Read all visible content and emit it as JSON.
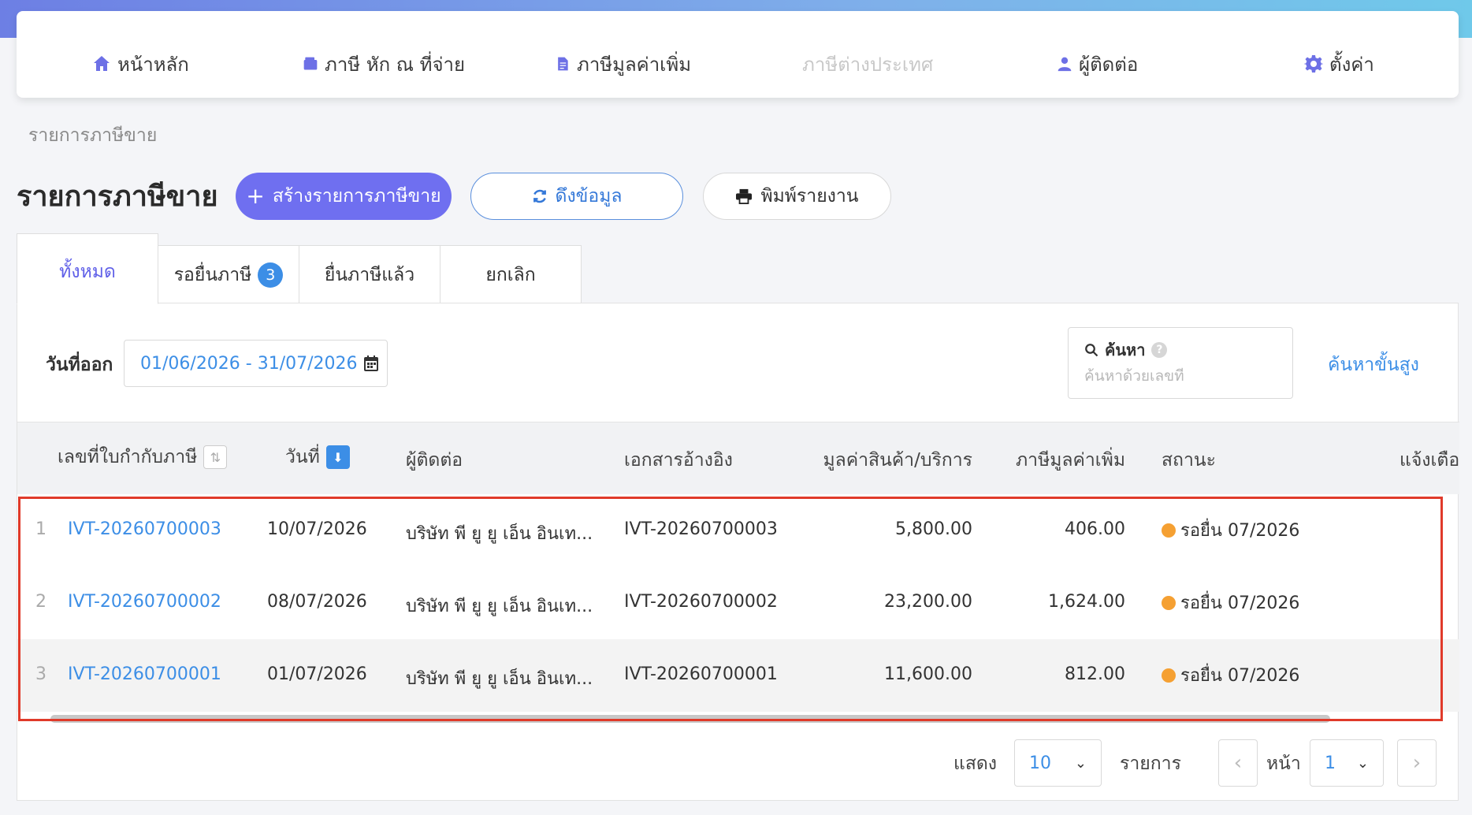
{
  "nav": {
    "home": "หน้าหลัก",
    "withholding": "ภาษี หัก ณ ที่จ่าย",
    "vat": "ภาษีมูลค่าเพิ่ม",
    "foreign": "ภาษีต่างประเทศ",
    "contacts": "ผู้ติดต่อ",
    "settings": "ตั้งค่า"
  },
  "breadcrumb": "รายการภาษีขาย",
  "page_title": "รายการภาษีขาย",
  "actions": {
    "create": "สร้างรายการภาษีขาย",
    "refresh": "ดึงข้อมูล",
    "print": "พิมพ์รายงาน"
  },
  "tabs": [
    {
      "label": "ทั้งหมด",
      "active": true
    },
    {
      "label": "รอยื่นภาษี",
      "badge": "3"
    },
    {
      "label": "ยื่นภาษีแล้ว"
    },
    {
      "label": "ยกเลิก"
    }
  ],
  "filter": {
    "date_label": "วันที่ออก",
    "date_range": "01/06/2026 - 31/07/2026",
    "search_label": "ค้นหา",
    "search_placeholder": "ค้นหาด้วยเลขที่",
    "advanced_search": "ค้นหาขั้นสูง"
  },
  "table": {
    "columns": {
      "invoice_no": "เลขที่ใบกำกับภาษี",
      "date": "วันที่",
      "contact": "ผู้ติดต่อ",
      "reference": "เอกสารอ้างอิง",
      "amount": "มูลค่าสินค้า/บริการ",
      "vat": "ภาษีมูลค่าเพิ่ม",
      "status": "สถานะ",
      "notify": "แจ้งเตือ"
    },
    "rows": [
      {
        "index": "1",
        "invoice_no": "IVT-20260700003",
        "date": "10/07/2026",
        "contact": "บริษัท พี ยู ยู เอ็น อินเท...",
        "reference": "IVT-20260700003",
        "amount": "5,800.00",
        "vat": "406.00",
        "status": "รอยื่น 07/2026"
      },
      {
        "index": "2",
        "invoice_no": "IVT-20260700002",
        "date": "08/07/2026",
        "contact": "บริษัท พี ยู ยู เอ็น อินเท...",
        "reference": "IVT-20260700002",
        "amount": "23,200.00",
        "vat": "1,624.00",
        "status": "รอยื่น 07/2026"
      },
      {
        "index": "3",
        "invoice_no": "IVT-20260700001",
        "date": "01/07/2026",
        "contact": "บริษัท พี ยู ยู เอ็น อินเท...",
        "reference": "IVT-20260700001",
        "amount": "11,600.00",
        "vat": "812.00",
        "status": "รอยื่น 07/2026"
      }
    ]
  },
  "pagination": {
    "show_label": "แสดง",
    "page_size": "10",
    "items_label": "รายการ",
    "page_label": "หน้า",
    "page": "1"
  },
  "colors": {
    "accent": "#6f6ff0",
    "link": "#3c8ee6",
    "status_pending": "#f5a032",
    "highlight": "#e03a2a"
  }
}
